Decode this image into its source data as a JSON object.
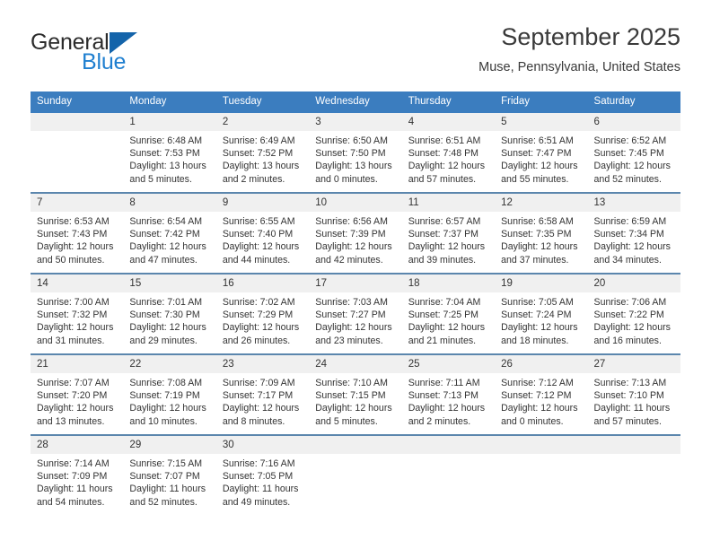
{
  "brand": {
    "name_top": "General",
    "name_bottom": "Blue",
    "logo_icon": "triangle-icon",
    "accent_color": "#1f7fd0",
    "triangle_color": "#1464aa"
  },
  "header": {
    "title": "September 2025",
    "subtitle": "Muse, Pennsylvania, United States"
  },
  "theme": {
    "header_row_bg": "#3b7dbf",
    "daynum_bg": "#f0f0f0",
    "row_divider": "#5b86ad",
    "text": "#333333"
  },
  "weekday_headers": [
    "Sunday",
    "Monday",
    "Tuesday",
    "Wednesday",
    "Thursday",
    "Friday",
    "Saturday"
  ],
  "labels": {
    "sunrise_prefix": "Sunrise:",
    "sunset_prefix": "Sunset:",
    "daylight_prefix": "Daylight:"
  },
  "weeks": [
    [
      {
        "day": "",
        "sunrise": "",
        "sunset": "",
        "daylight": "",
        "empty": true
      },
      {
        "day": "1",
        "sunrise": "Sunrise: 6:48 AM",
        "sunset": "Sunset: 7:53 PM",
        "daylight": "Daylight: 13 hours and 5 minutes."
      },
      {
        "day": "2",
        "sunrise": "Sunrise: 6:49 AM",
        "sunset": "Sunset: 7:52 PM",
        "daylight": "Daylight: 13 hours and 2 minutes."
      },
      {
        "day": "3",
        "sunrise": "Sunrise: 6:50 AM",
        "sunset": "Sunset: 7:50 PM",
        "daylight": "Daylight: 13 hours and 0 minutes."
      },
      {
        "day": "4",
        "sunrise": "Sunrise: 6:51 AM",
        "sunset": "Sunset: 7:48 PM",
        "daylight": "Daylight: 12 hours and 57 minutes."
      },
      {
        "day": "5",
        "sunrise": "Sunrise: 6:51 AM",
        "sunset": "Sunset: 7:47 PM",
        "daylight": "Daylight: 12 hours and 55 minutes."
      },
      {
        "day": "6",
        "sunrise": "Sunrise: 6:52 AM",
        "sunset": "Sunset: 7:45 PM",
        "daylight": "Daylight: 12 hours and 52 minutes."
      }
    ],
    [
      {
        "day": "7",
        "sunrise": "Sunrise: 6:53 AM",
        "sunset": "Sunset: 7:43 PM",
        "daylight": "Daylight: 12 hours and 50 minutes."
      },
      {
        "day": "8",
        "sunrise": "Sunrise: 6:54 AM",
        "sunset": "Sunset: 7:42 PM",
        "daylight": "Daylight: 12 hours and 47 minutes."
      },
      {
        "day": "9",
        "sunrise": "Sunrise: 6:55 AM",
        "sunset": "Sunset: 7:40 PM",
        "daylight": "Daylight: 12 hours and 44 minutes."
      },
      {
        "day": "10",
        "sunrise": "Sunrise: 6:56 AM",
        "sunset": "Sunset: 7:39 PM",
        "daylight": "Daylight: 12 hours and 42 minutes."
      },
      {
        "day": "11",
        "sunrise": "Sunrise: 6:57 AM",
        "sunset": "Sunset: 7:37 PM",
        "daylight": "Daylight: 12 hours and 39 minutes."
      },
      {
        "day": "12",
        "sunrise": "Sunrise: 6:58 AM",
        "sunset": "Sunset: 7:35 PM",
        "daylight": "Daylight: 12 hours and 37 minutes."
      },
      {
        "day": "13",
        "sunrise": "Sunrise: 6:59 AM",
        "sunset": "Sunset: 7:34 PM",
        "daylight": "Daylight: 12 hours and 34 minutes."
      }
    ],
    [
      {
        "day": "14",
        "sunrise": "Sunrise: 7:00 AM",
        "sunset": "Sunset: 7:32 PM",
        "daylight": "Daylight: 12 hours and 31 minutes."
      },
      {
        "day": "15",
        "sunrise": "Sunrise: 7:01 AM",
        "sunset": "Sunset: 7:30 PM",
        "daylight": "Daylight: 12 hours and 29 minutes."
      },
      {
        "day": "16",
        "sunrise": "Sunrise: 7:02 AM",
        "sunset": "Sunset: 7:29 PM",
        "daylight": "Daylight: 12 hours and 26 minutes."
      },
      {
        "day": "17",
        "sunrise": "Sunrise: 7:03 AM",
        "sunset": "Sunset: 7:27 PM",
        "daylight": "Daylight: 12 hours and 23 minutes."
      },
      {
        "day": "18",
        "sunrise": "Sunrise: 7:04 AM",
        "sunset": "Sunset: 7:25 PM",
        "daylight": "Daylight: 12 hours and 21 minutes."
      },
      {
        "day": "19",
        "sunrise": "Sunrise: 7:05 AM",
        "sunset": "Sunset: 7:24 PM",
        "daylight": "Daylight: 12 hours and 18 minutes."
      },
      {
        "day": "20",
        "sunrise": "Sunrise: 7:06 AM",
        "sunset": "Sunset: 7:22 PM",
        "daylight": "Daylight: 12 hours and 16 minutes."
      }
    ],
    [
      {
        "day": "21",
        "sunrise": "Sunrise: 7:07 AM",
        "sunset": "Sunset: 7:20 PM",
        "daylight": "Daylight: 12 hours and 13 minutes."
      },
      {
        "day": "22",
        "sunrise": "Sunrise: 7:08 AM",
        "sunset": "Sunset: 7:19 PM",
        "daylight": "Daylight: 12 hours and 10 minutes."
      },
      {
        "day": "23",
        "sunrise": "Sunrise: 7:09 AM",
        "sunset": "Sunset: 7:17 PM",
        "daylight": "Daylight: 12 hours and 8 minutes."
      },
      {
        "day": "24",
        "sunrise": "Sunrise: 7:10 AM",
        "sunset": "Sunset: 7:15 PM",
        "daylight": "Daylight: 12 hours and 5 minutes."
      },
      {
        "day": "25",
        "sunrise": "Sunrise: 7:11 AM",
        "sunset": "Sunset: 7:13 PM",
        "daylight": "Daylight: 12 hours and 2 minutes."
      },
      {
        "day": "26",
        "sunrise": "Sunrise: 7:12 AM",
        "sunset": "Sunset: 7:12 PM",
        "daylight": "Daylight: 12 hours and 0 minutes."
      },
      {
        "day": "27",
        "sunrise": "Sunrise: 7:13 AM",
        "sunset": "Sunset: 7:10 PM",
        "daylight": "Daylight: 11 hours and 57 minutes."
      }
    ],
    [
      {
        "day": "28",
        "sunrise": "Sunrise: 7:14 AM",
        "sunset": "Sunset: 7:09 PM",
        "daylight": "Daylight: 11 hours and 54 minutes."
      },
      {
        "day": "29",
        "sunrise": "Sunrise: 7:15 AM",
        "sunset": "Sunset: 7:07 PM",
        "daylight": "Daylight: 11 hours and 52 minutes."
      },
      {
        "day": "30",
        "sunrise": "Sunrise: 7:16 AM",
        "sunset": "Sunset: 7:05 PM",
        "daylight": "Daylight: 11 hours and 49 minutes."
      },
      {
        "day": "",
        "sunrise": "",
        "sunset": "",
        "daylight": "",
        "empty": true
      },
      {
        "day": "",
        "sunrise": "",
        "sunset": "",
        "daylight": "",
        "empty": true
      },
      {
        "day": "",
        "sunrise": "",
        "sunset": "",
        "daylight": "",
        "empty": true
      },
      {
        "day": "",
        "sunrise": "",
        "sunset": "",
        "daylight": "",
        "empty": true
      }
    ]
  ]
}
